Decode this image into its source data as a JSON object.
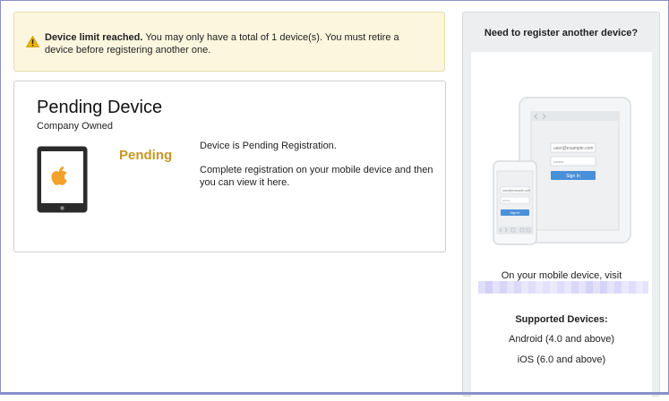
{
  "alert": {
    "title": "Device limit reached.",
    "message": "You may only have a total of 1 device(s). You must retire a device before registering another one."
  },
  "device": {
    "name": "Pending Device",
    "ownership": "Company Owned",
    "state": "Pending",
    "status_line": "Device is Pending Registration.",
    "instruction": "Complete registration on your mobile device and then you can view it here.",
    "icon": "ipad-apple-icon"
  },
  "sidebar": {
    "heading": "Need to register another device?",
    "visit_text": "On your mobile device, visit",
    "supported_heading": "Supported Devices:",
    "supported": [
      "Android (4.0 and above)",
      "iOS (6.0 and above)"
    ],
    "illustration": {
      "email_placeholder": "user@example.com",
      "password_placeholder": "••••••••",
      "button_label": "Sign In"
    }
  },
  "colors": {
    "alert_bg": "#fcf6de",
    "pending": "#c8962a",
    "sign_in": "#4a90d9"
  }
}
